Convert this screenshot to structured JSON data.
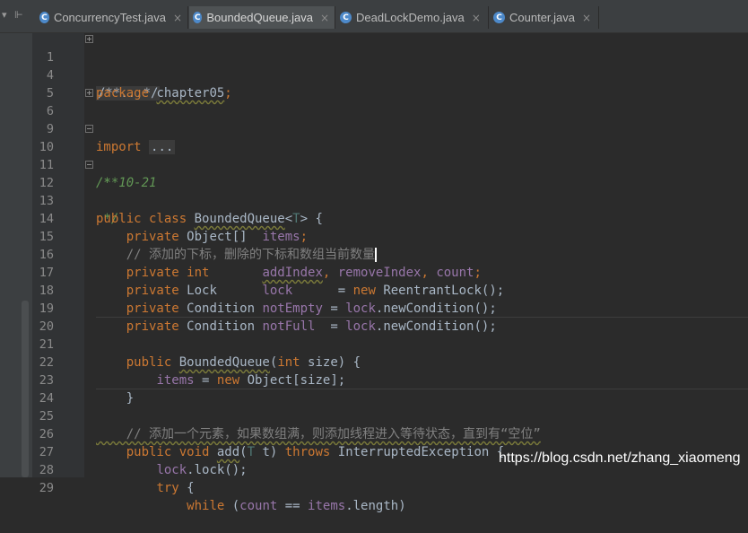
{
  "tabs": [
    {
      "label": "ConcurrencyTest.java",
      "icon": "C",
      "active": false
    },
    {
      "label": "BoundedQueue.java",
      "icon": "C",
      "active": true
    },
    {
      "label": "DeadLockDemo.java",
      "icon": "C",
      "active": false
    },
    {
      "label": "Counter.java",
      "icon": "C",
      "active": false
    }
  ],
  "close_glyph": "×",
  "lines": {
    "l1": {
      "n": "1",
      "a": "/**...*/"
    },
    "l4": {
      "n": "4",
      "a": "package ",
      "b": "chapter05",
      "c": ";"
    },
    "l5": {
      "n": "5"
    },
    "l6": {
      "n": "6",
      "a": "import ",
      "b": "..."
    },
    "l9": {
      "n": "9"
    },
    "l10": {
      "n": "10",
      "a": "/**"
    },
    "l11": {
      "n": "11",
      "a": " * 10-21"
    },
    "l12": {
      "n": "12",
      "a": " */"
    },
    "l13": {
      "n": "13",
      "a": "public class ",
      "b": "BoundedQueue",
      "c": "<",
      "d": "T",
      "e": "> {"
    },
    "l14": {
      "n": "14",
      "a": "    private ",
      "b": "Object[]  ",
      "c": "items",
      "d": ";"
    },
    "l15": {
      "n": "15",
      "a": "    // 添加的下标，删除的下标和数组当前数量"
    },
    "l16": {
      "n": "16",
      "a": "    private int       ",
      "b": "addIndex",
      "c": ", ",
      "d": "removeIndex",
      "e": ", ",
      "f": "count",
      "g": ";"
    },
    "l17": {
      "n": "17",
      "a": "    private ",
      "b": "Lock      ",
      "c": "lock",
      "d": "      = ",
      "e": "new ",
      "f": "ReentrantLock();"
    },
    "l18": {
      "n": "18",
      "a": "    private ",
      "b": "Condition ",
      "c": "notEmpty",
      "d": " = ",
      "e": "lock",
      "f": ".newCondition();"
    },
    "l19": {
      "n": "19",
      "a": "    private ",
      "b": "Condition ",
      "c": "notFull",
      "d": "  = ",
      "e": "lock",
      "f": ".newCondition();"
    },
    "l20": {
      "n": "20"
    },
    "l21": {
      "n": "21",
      "a": "    public ",
      "b": "BoundedQueue",
      "c": "(",
      "d": "int ",
      "e": "size) {"
    },
    "l22": {
      "n": "22",
      "a": "        ",
      "b": "items",
      "c": " = ",
      "d": "new ",
      "e": "Object[size];"
    },
    "l23": {
      "n": "23",
      "a": "    }"
    },
    "l24": {
      "n": "24"
    },
    "l25": {
      "n": "25",
      "a": "    // 添加一个元素，如果数组满，则添加线程进入等待状态，直到有“空位”"
    },
    "l26": {
      "n": "26",
      "a": "    public void ",
      "b": "add",
      "c": "(",
      "d": "T",
      "e": " t) ",
      "f": "throws ",
      "g": "InterruptedException {"
    },
    "l27": {
      "n": "27",
      "a": "        ",
      "b": "lock",
      "c": ".lock();"
    },
    "l28": {
      "n": "28",
      "a": "        ",
      "b": "try ",
      "c": "{"
    },
    "l29": {
      "n": "29",
      "a": "            ",
      "b": "while ",
      "c": "(",
      "d": "count",
      "e": " == ",
      "f": "items",
      "g": ".length)"
    }
  },
  "watermark": "https://blog.csdn.net/zhang_xiaomeng"
}
